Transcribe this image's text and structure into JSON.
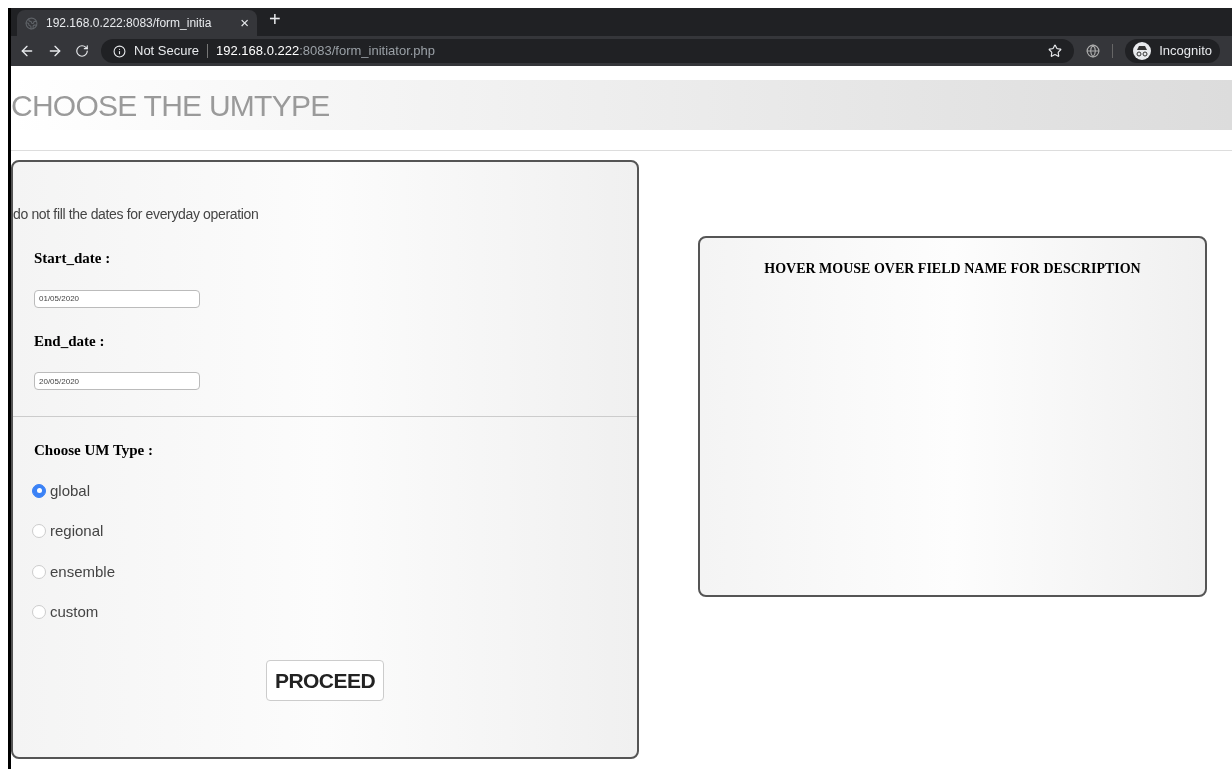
{
  "browser": {
    "tab": {
      "title": "192.168.0.222:8083/form_initia",
      "close": "×",
      "selected": true
    },
    "new_tab": "+",
    "security": "Not Secure",
    "url_host": "192.168.0.222",
    "url_path": ":8083/form_initiator.php",
    "profile": "Incognito"
  },
  "page": {
    "title": "CHOOSE THE UMTYPE",
    "form": {
      "note": "do not fill the dates for everyday operation",
      "fields": [
        {
          "label": "Start_date :",
          "value": "01/05/2020"
        },
        {
          "label": "End_date :",
          "value": "20/05/2020"
        }
      ],
      "type_label": "Choose UM Type :",
      "options": [
        {
          "label": "global",
          "selected": true
        },
        {
          "label": "regional",
          "selected": false
        },
        {
          "label": "ensemble",
          "selected": false
        },
        {
          "label": "custom",
          "selected": false
        }
      ],
      "button": "PROCEED"
    },
    "description": {
      "title": "HOVER MOUSE OVER FIELD NAME FOR DESCRIPTION"
    }
  }
}
